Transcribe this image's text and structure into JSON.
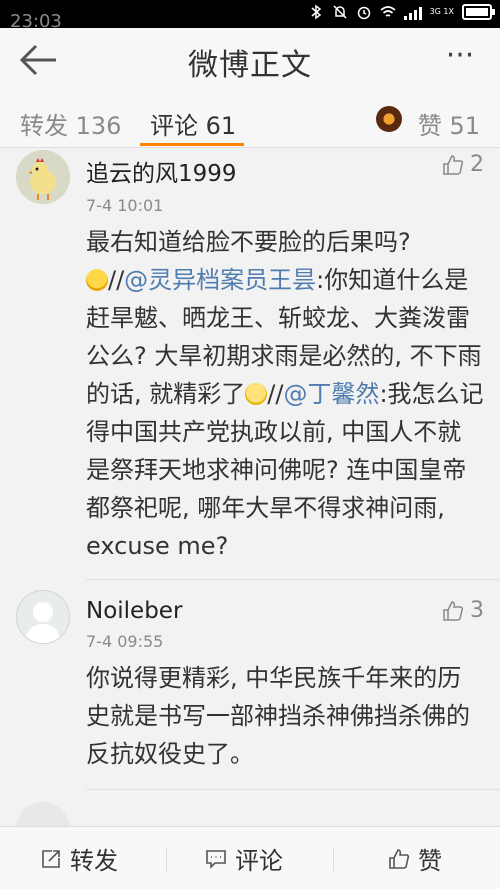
{
  "status_bar": {
    "time": "23:03",
    "network": "3G 1X"
  },
  "header": {
    "title": "微博正文",
    "more": "···"
  },
  "tabs": {
    "repost": "转发 136",
    "comments": "评论 61",
    "likes": "赞 51"
  },
  "comments": [
    {
      "username": "追云的风1999",
      "likes": "2",
      "time": "7-4 10:01",
      "text_1": "最右知道给脸不要脸的后果吗?",
      "text_2": "//",
      "mention_1": "@灵异档案员王昙",
      "text_3": ":你知道什么是赶旱魃、晒龙王、斩蛟龙、大粪泼雷公么? 大旱初期求雨是必然的, 不下雨的话, 就精彩了",
      "text_4": "//",
      "mention_2": "@丁馨然",
      "text_5": ":我怎么记得中国共产党执政以前, 中国人不就是祭拜天地求神问佛呢? 连中国皇帝都祭祀呢, 哪年大旱不得求神问雨, excuse me?"
    },
    {
      "username": "Noileber",
      "likes": "3",
      "time": "7-4 09:55",
      "text": "你说得更精彩, 中华民族千年来的历史就是书写一部神挡杀神佛挡杀佛的反抗奴役史了。"
    }
  ],
  "bottom_bar": {
    "repost": "转发",
    "comment": "评论",
    "like": "赞"
  },
  "colors": {
    "accent": "#ff8200",
    "mention": "#507daf"
  }
}
